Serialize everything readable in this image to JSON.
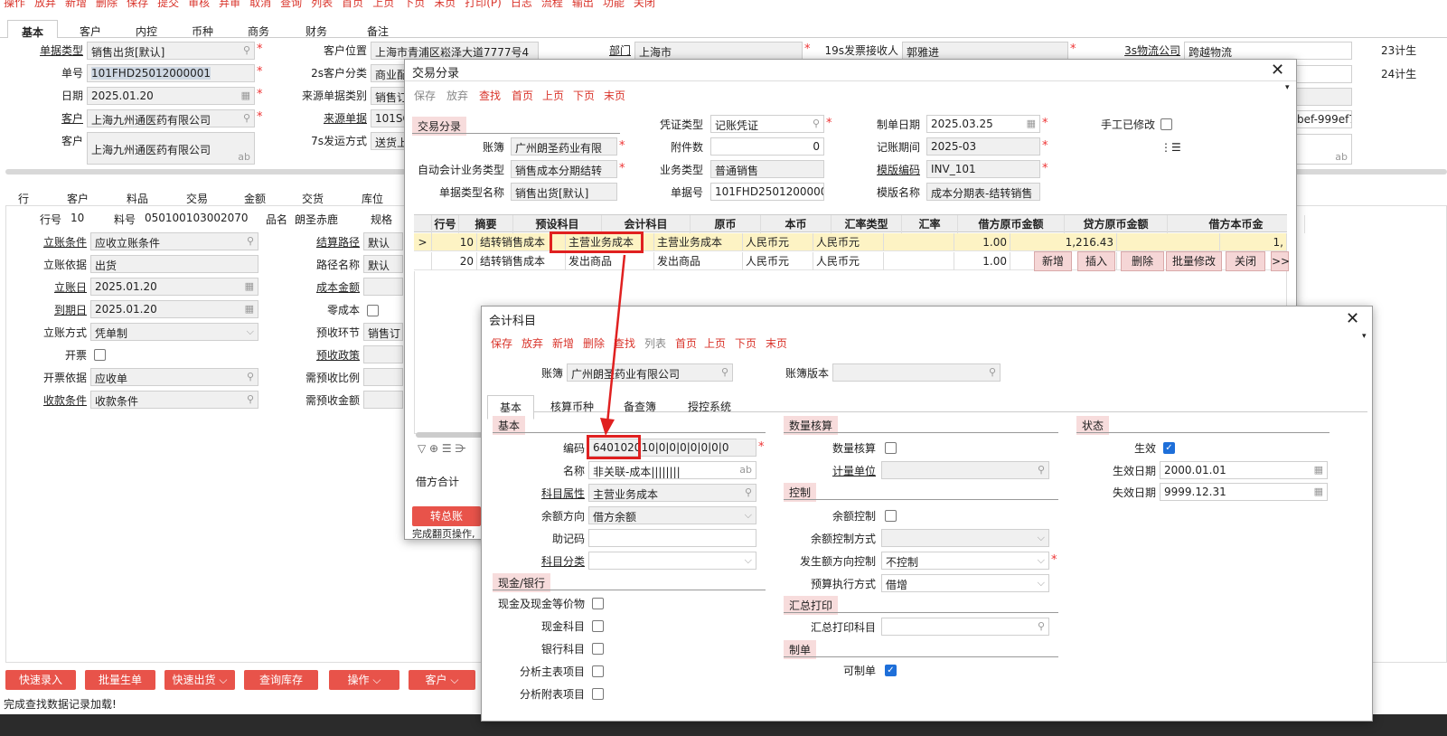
{
  "topmenu": [
    "操作",
    "放弃",
    "新增",
    "删除",
    "保存",
    "提交",
    "审核",
    "弃审",
    "取消",
    "查询",
    "列表",
    "首页",
    "上页",
    "下页",
    "末页",
    "打印(P)",
    "日志",
    "流程",
    "输出",
    "功能",
    "关闭"
  ],
  "tabs": [
    "基本",
    "客户",
    "内控",
    "币种",
    "商务",
    "财务",
    "备注"
  ],
  "header": {
    "doc_type_label": "单据类型",
    "doc_type": "销售出货[默认]",
    "doc_no_label": "单号",
    "doc_no": "101FHD25012000001",
    "date_label": "日期",
    "date": "2025.01.20",
    "cust_label": "客户",
    "cust": "上海九州通医药有限公司",
    "cust2_label": "客户",
    "cust2": "上海九州通医药有限公司",
    "cust_loc_label": "客户位置",
    "cust_loc": "上海市青浦区崧泽大道7777号4",
    "cust_cls_label": "2s客户分类",
    "cust_cls": "商业配",
    "src_type_label": "来源单据类别",
    "src_type": "销售订",
    "src_doc_label": "来源单据",
    "src_doc": "101SO",
    "ship_label": "7s发运方式",
    "ship": "送货上",
    "dept_label": "部门",
    "dept": "上海市",
    "invoice_label": "19s发票接收人",
    "invoice": "郭雅进",
    "logi_label": "3s物流公司",
    "logi": "跨越物流",
    "c23_label": "23计生",
    "c24_label": "24计生",
    "c_uuid": "bef-999ef7"
  },
  "grid_headers": [
    "行",
    "客户",
    "料品",
    "交易",
    "金额",
    "交货",
    "库位"
  ],
  "detail": {
    "row_label": "行号",
    "row": "10",
    "item_label": "料号",
    "item": "050100103002070",
    "name_label": "品名",
    "name": "朗圣赤鹿",
    "spec_label": "规格",
    "f1_label": "立账条件",
    "f1": "应收立账条件",
    "f2_label": "立账依据",
    "f2": "出货",
    "f3_label": "立账日",
    "f3": "2025.01.20",
    "f4_label": "到期日",
    "f4": "2025.01.20",
    "f5_label": "立账方式",
    "f5": "凭单制",
    "f6_label": "开票",
    "f7_label": "开票依据",
    "f7": "应收单",
    "f8_label": "收款条件",
    "f8": "收款条件",
    "g1_label": "结算路径",
    "g1": "默认",
    "g2_label": "路径名称",
    "g2": "默认",
    "g3_label": "成本金额",
    "g4_label": "零成本",
    "g5_label": "预收环节",
    "g5": "销售订",
    "g6_label": "预收政策",
    "g7_label": "需预收比例",
    "g8_label": "需预收金额"
  },
  "bottom_buttons": [
    "快速录入",
    "批量生单",
    "快速出货 ⌵",
    "查询库存",
    "操作 ⌵",
    "客户 ⌵"
  ],
  "status": "完成查找数据记录加载!",
  "jy": {
    "title": "交易分录",
    "toolbar": [
      "保存",
      "放弃",
      "查找",
      "首页",
      "上页",
      "下页",
      "末页"
    ],
    "sect": "交易分录",
    "acct_label": "账簿",
    "acct": "广州朗圣药业有限",
    "auto_label": "自动会计业务类型",
    "auto": "销售成本分期结转",
    "doctype_label": "单据类型名称",
    "doctype": "销售出货[默认]",
    "vtype_label": "凭证类型",
    "vtype": "记账凭证",
    "att_label": "附件数",
    "att": "0",
    "biz_label": "业务类型",
    "biz": "普通销售",
    "docno_label": "单据号",
    "docno": "101FHD25012000001_",
    "mdate_label": "制单日期",
    "mdate": "2025.03.25",
    "period_label": "记账期间",
    "period": "2025-03",
    "tcode_label": "模版编码",
    "tcode": "INV_101",
    "tname_label": "模版名称",
    "tname": "成本分期表-结转销售",
    "manual_label": "手工已修改",
    "cols": [
      "行号",
      "摘要",
      "预设科目",
      "会计科目",
      "原币",
      "本币",
      "汇率类型",
      "汇率",
      "借方原币金额",
      "贷方原币金额",
      "借方本币金"
    ],
    "rows": [
      {
        "mark": ">",
        "no": "10",
        "desc": "结转销售成本",
        "preset": "主营业务成本",
        "acct": "主营业务成本",
        "cur": "人民币元",
        "lcur": "人民币元",
        "rate": "1.00",
        "debit": "1,216.43",
        "ldebit": "1,"
      },
      {
        "mark": "",
        "no": "20",
        "desc": "结转销售成本",
        "preset": "发出商品",
        "acct": "发出商品",
        "cur": "人民币元",
        "lcur": "人民币元",
        "rate": "1.00",
        "debit": "",
        "ldebit": ""
      }
    ],
    "rowbtns": [
      "新增",
      "插入",
      "删除",
      "批量修改",
      "关闭",
      ">>"
    ],
    "debit_total_label": "借方合计",
    "post_btn": "转总账",
    "status": "完成翻页操作,"
  },
  "kj": {
    "title": "会计科目",
    "toolbar": [
      "保存",
      "放弃",
      "新增",
      "删除",
      "查找",
      "列表",
      "首页",
      "上页",
      "下页",
      "末页"
    ],
    "acct_label": "账簿",
    "acct": "广州朗圣药业有限公司",
    "ver_label": "账簿版本",
    "tabs": [
      "基本",
      "核算币种",
      "备查簿",
      "授控系统"
    ],
    "s_basic": "基本",
    "s_qty": "数量核算",
    "s_status": "状态",
    "s_ctrl": "控制",
    "s_cash": "现金/银行",
    "s_sum": "汇总打印",
    "s_make": "制单",
    "code_label": "编码",
    "code": "64010201",
    "code_rest": "0|0|0|0|0|0|0|0",
    "name_label": "名称",
    "name": "非关联-成本||||||||",
    "attr_label": "科目属性",
    "attr": "主营业务成本",
    "dir_label": "余额方向",
    "dir": "借方余额",
    "memo_label": "助记码",
    "cls_label": "科目分类",
    "cash1": "现金及现金等价物",
    "cash2": "现金科目",
    "cash3": "银行科目",
    "cash4": "分析主表项目",
    "cash5": "分析附表项目",
    "qty_label": "数量核算",
    "unit_label": "计量单位",
    "bal_label": "余额控制",
    "balm_label": "余额控制方式",
    "occ_label": "发生额方向控制",
    "occ": "不控制",
    "bud_label": "预算执行方式",
    "bud": "借增",
    "sump_label": "汇总打印科目",
    "canmake_label": "可制单",
    "eff_label": "生效",
    "effd_label": "生效日期",
    "effd": "2000.01.01",
    "exp_label": "失效日期",
    "exp": "9999.12.31"
  }
}
